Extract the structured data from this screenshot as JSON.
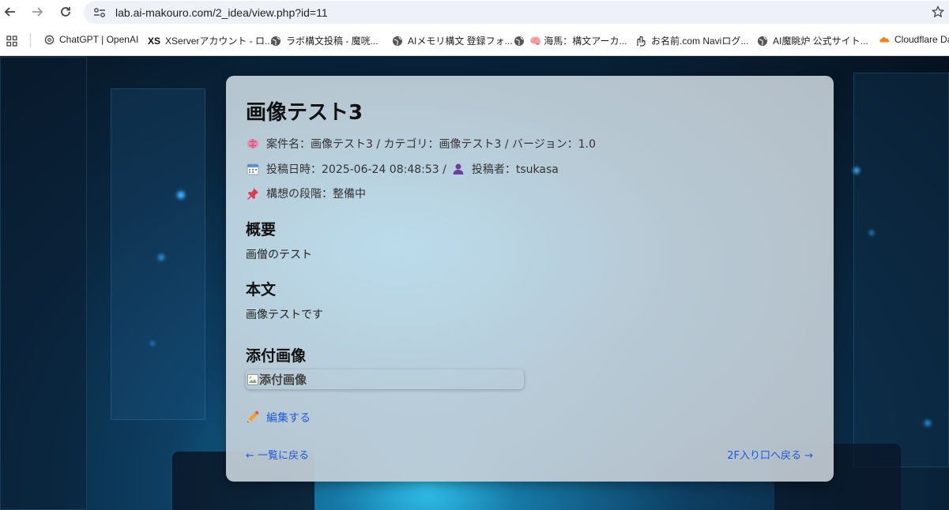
{
  "browser": {
    "url": "lab.ai-makouro.com/2_idea/view.php?id=11",
    "bookmarks": [
      {
        "label": "ChatGPT | OpenAI",
        "icon": "openai-icon"
      },
      {
        "label": "XServerアカウント - ロ...",
        "icon": "xserver-icon",
        "prefix": "XS"
      },
      {
        "label": "ラボ構文投稿 - 魔咣...",
        "icon": "globe-icon"
      },
      {
        "label": "AIメモリ構文 登録フォ...",
        "icon": "globe-icon"
      },
      {
        "label": "🧠 海馬：構文アーカ...",
        "icon": "globe-icon"
      },
      {
        "label": "お名前.com Naviログ...",
        "icon": "onamae-icon"
      },
      {
        "label": "AI魔眺炉 公式サイト...",
        "icon": "globe-icon"
      },
      {
        "label": "Cloudflare Da",
        "icon": "cloudflare-icon"
      }
    ]
  },
  "post": {
    "title": "画像テスト3",
    "meta_line1": "案件名：画像テスト3 / カテゴリ：画像テスト3 / バージョン：1.0",
    "meta_posted": "投稿日時：2025-06-24 08:48:53 / ",
    "meta_author": "投稿者：tsukasa",
    "meta_stage": "構想の段階：整備中",
    "summary_heading": "概要",
    "summary_text": "画僧のテスト",
    "body_heading": "本文",
    "body_text": "画像テストです",
    "attachment_heading": "添付画像",
    "attachment_alt": "添付画像",
    "edit_label": "編集する",
    "back_list_label": "← 一覧に戻る",
    "back_entrance_label": "2F入り口へ戻る →"
  },
  "colors": {
    "link": "#1f5bd8",
    "card_bg": "#c4d4de"
  }
}
